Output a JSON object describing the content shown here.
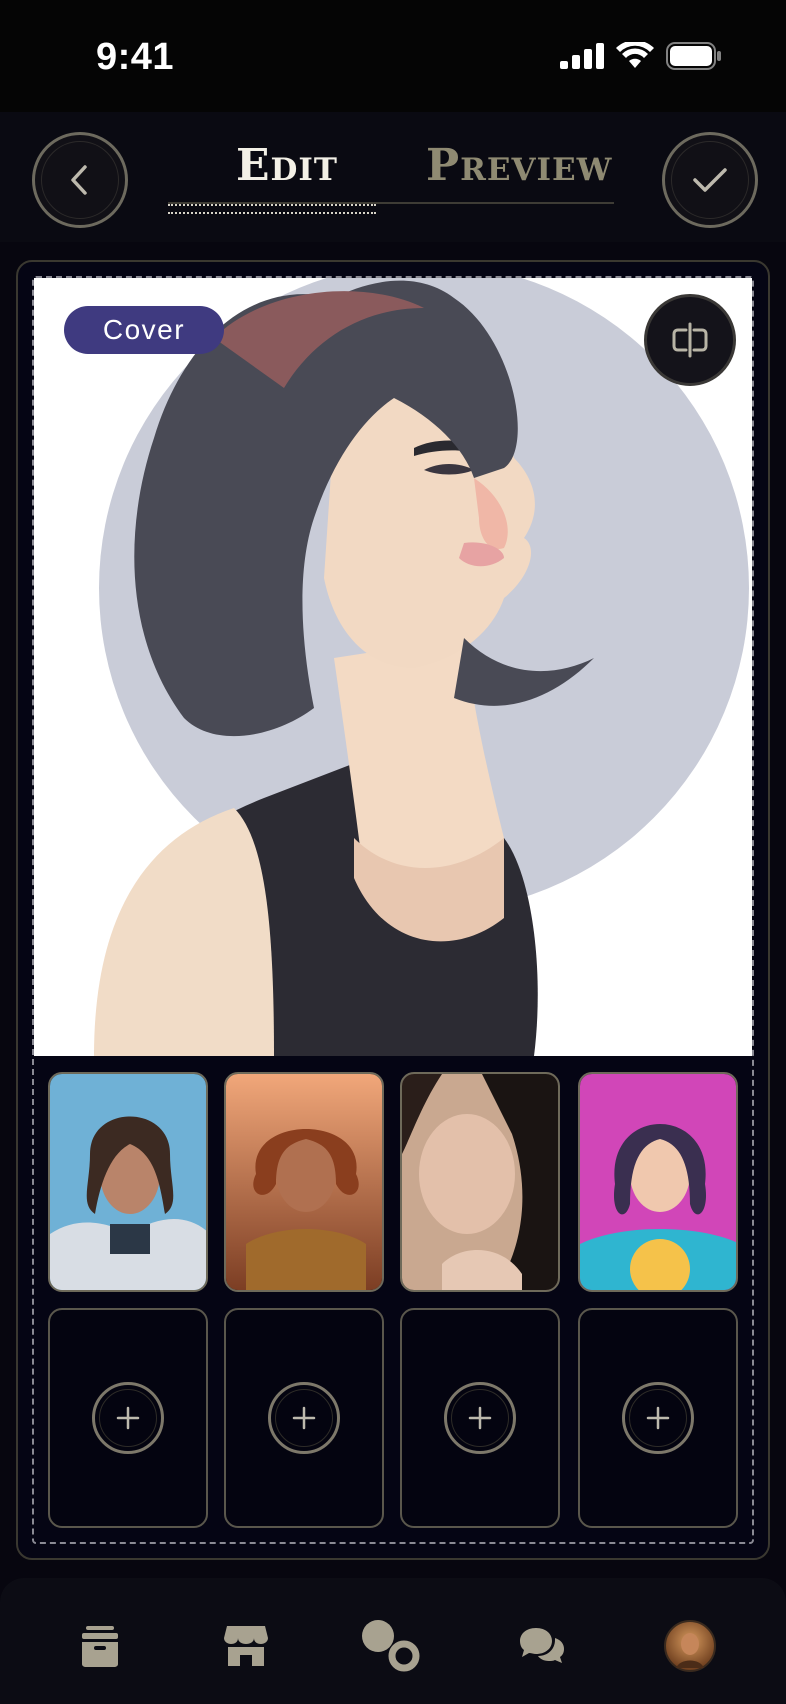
{
  "status_bar": {
    "time": "9:41"
  },
  "header": {
    "tab_edit": "Edit",
    "tab_preview": "Preview"
  },
  "cover": {
    "badge": "Cover"
  },
  "thumbnails": [
    {
      "name": "portrait-astronaut"
    },
    {
      "name": "portrait-golden-armor"
    },
    {
      "name": "portrait-dark-hair"
    },
    {
      "name": "portrait-anime-pink"
    }
  ],
  "empty_slots": 4,
  "bottom_nav": [
    "archive-icon",
    "store-icon",
    "bubbles-icon",
    "chat-icon",
    "profile-avatar"
  ],
  "colors": {
    "accent": "#3f3a80",
    "gold": "#8f8a72",
    "background": "#07060f"
  }
}
